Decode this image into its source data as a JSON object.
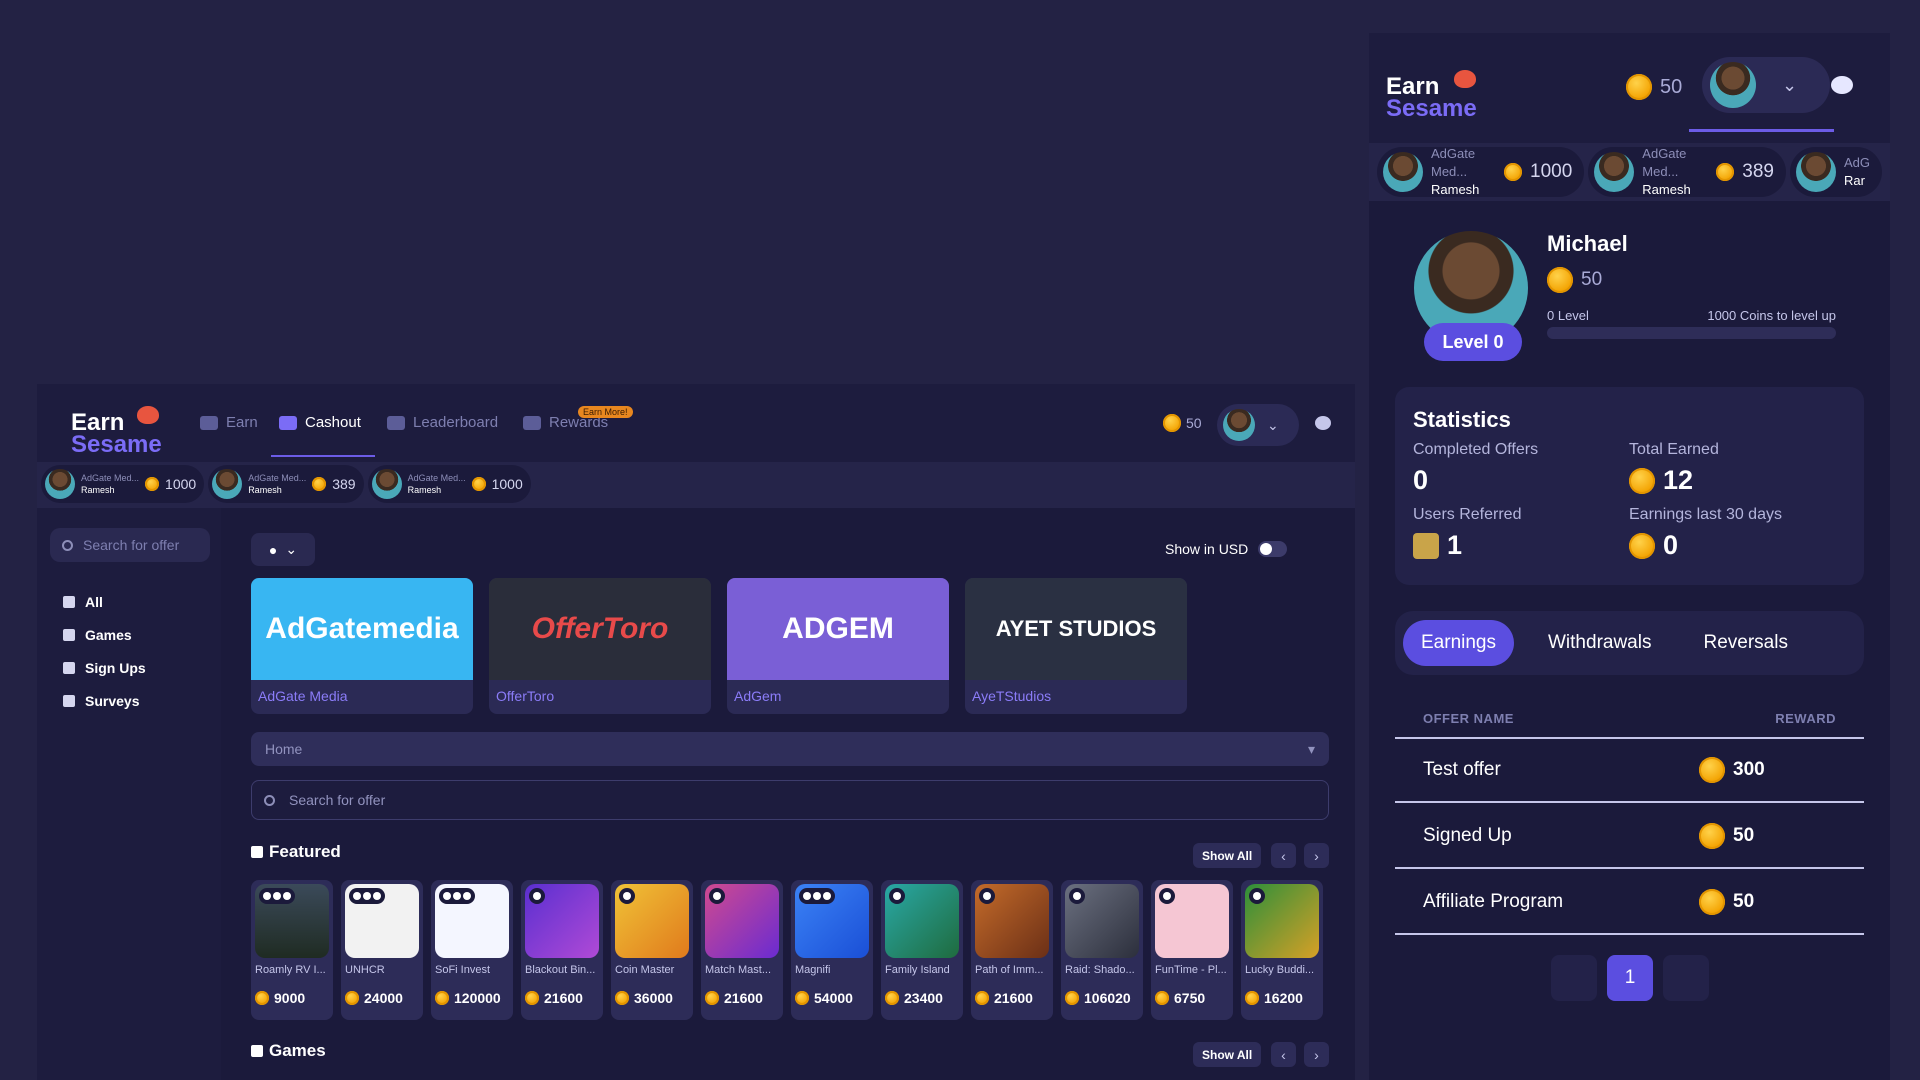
{
  "brand": {
    "line1": "Earn",
    "line2": "Sesame"
  },
  "nav": {
    "items": [
      {
        "label": "Earn",
        "icon": "cloud-icon"
      },
      {
        "label": "Cashout",
        "icon": "wallet-icon"
      },
      {
        "label": "Leaderboard",
        "icon": "crown-icon"
      },
      {
        "label": "Rewards",
        "icon": "gift-icon"
      }
    ],
    "badge": "Earn More!",
    "coins": "50"
  },
  "ticker": [
    {
      "source": "AdGate Med...",
      "user": "Ramesh",
      "amount": "1000"
    },
    {
      "source": "AdGate Med...",
      "user": "Ramesh",
      "amount": "389"
    },
    {
      "source": "AdGate Med...",
      "user": "Ramesh",
      "amount": "1000"
    }
  ],
  "sidebar": {
    "search_placeholder": "Search for offer",
    "items": [
      {
        "label": "All",
        "icon": "rocket-icon"
      },
      {
        "label": "Games",
        "icon": "gamepad-icon"
      },
      {
        "label": "Sign Ups",
        "icon": "pen-icon"
      },
      {
        "label": "Surveys",
        "icon": "clipboard-icon"
      }
    ]
  },
  "content": {
    "os_icon": "apple-icon",
    "usd_label": "Show in USD",
    "walls": [
      {
        "banner": "AdGatemedia",
        "label": "AdGate Media",
        "color": "#38b6f2"
      },
      {
        "banner": "OfferToro",
        "label": "OfferToro",
        "color": "#2a2d3a"
      },
      {
        "banner": "ADGEM",
        "label": "AdGem",
        "color": "#7a5fd6"
      },
      {
        "banner": "AYET STUDIOS",
        "label": "AyeTStudios",
        "color": "#2a3042"
      }
    ],
    "category": "Home",
    "search_placeholder": "Search for offer",
    "featured_title": "Featured",
    "games_title": "Games",
    "show_all": "Show All",
    "prev": "‹",
    "next": "›",
    "featured": [
      {
        "name": "Roamly RV I...",
        "value": "9000"
      },
      {
        "name": "UNHCR",
        "value": "24000"
      },
      {
        "name": "SoFi Invest",
        "value": "120000"
      },
      {
        "name": "Blackout Bin...",
        "value": "21600"
      },
      {
        "name": "Coin Master",
        "value": "36000"
      },
      {
        "name": "Match Mast...",
        "value": "21600"
      },
      {
        "name": "Magnifi",
        "value": "54000"
      },
      {
        "name": "Family Island",
        "value": "23400"
      },
      {
        "name": "Path of Imm...",
        "value": "21600"
      },
      {
        "name": "Raid: Shado...",
        "value": "106020"
      },
      {
        "name": "FunTime - Pl...",
        "value": "6750"
      },
      {
        "name": "Lucky Buddi...",
        "value": "16200"
      }
    ]
  },
  "panel": {
    "coins": "50",
    "ticker": [
      {
        "source": "AdGate Med...",
        "user": "Ramesh",
        "amount": "1000"
      },
      {
        "source": "AdGate Med...",
        "user": "Ramesh",
        "amount": "389"
      },
      {
        "source": "AdG",
        "user": "Rar",
        "amount": ""
      }
    ],
    "profile": {
      "name": "Michael",
      "balance": "50",
      "level_badge": "Level 0",
      "level_left": "0 Level",
      "level_right": "1000 Coins to level up",
      "progress_fraction": 0.0
    },
    "stats": {
      "title": "Statistics",
      "completed_label": "Completed Offers",
      "completed_value": "0",
      "earned_label": "Total Earned",
      "earned_value": "12",
      "referred_label": "Users Referred",
      "referred_value": "1",
      "last30_label": "Earnings last 30 days",
      "last30_value": "0"
    },
    "tabs": [
      "Earnings",
      "Withdrawals",
      "Reversals"
    ],
    "table": {
      "col_name": "OFFER NAME",
      "col_reward": "REWARD",
      "rows": [
        {
          "name": "Test offer",
          "reward": "300"
        },
        {
          "name": "Signed Up",
          "reward": "50"
        },
        {
          "name": "Affiliate Program",
          "reward": "50"
        }
      ]
    },
    "pagination": {
      "current": "1"
    }
  }
}
